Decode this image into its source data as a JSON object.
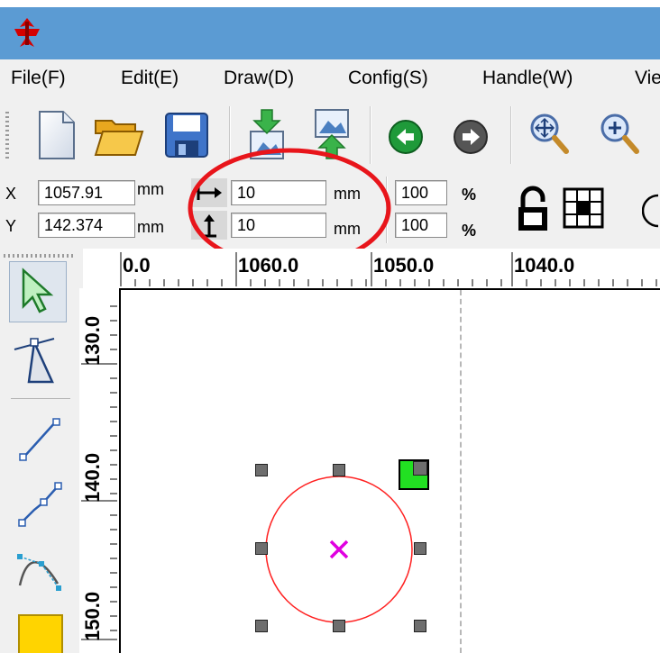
{
  "window": {
    "logo_icon": "app-logo-icon",
    "accent": "#5b9bd3"
  },
  "menu": {
    "items": [
      "File(F)",
      "Edit(E)",
      "Draw(D)",
      "Config(S)",
      "Handle(W)",
      "Vie"
    ]
  },
  "toolbar": {
    "icons": [
      "new-file-icon",
      "open-folder-icon",
      "save-icon",
      "import-icon",
      "export-icon",
      "back-arrow-icon",
      "forward-arrow-icon",
      "zoom-pan-icon",
      "zoom-in-icon"
    ]
  },
  "position": {
    "x_label": "X",
    "x_value": "1057.91",
    "x_unit": "mm",
    "y_label": "Y",
    "y_value": "142.374",
    "y_unit": "mm"
  },
  "size": {
    "width_value": "10",
    "width_unit": "mm",
    "height_value": "10",
    "height_unit": "mm"
  },
  "scale": {
    "x_value": "100",
    "x_unit": "%",
    "y_value": "100",
    "y_unit": "%"
  },
  "ruler": {
    "top_labels": [
      "0.0",
      "1060.0",
      "1050.0",
      "1040.0"
    ],
    "left_labels": [
      "130.0",
      "140.0",
      "150.0"
    ]
  },
  "tools": [
    "select-arrow-icon",
    "node-edit-icon",
    "line-icon",
    "polyline-icon",
    "bezier-curve-icon",
    "rectangle-icon"
  ],
  "colors": {
    "highlight_ellipse": "#e8151b",
    "circle_stroke": "#ff2020",
    "center_mark": "#e000e0",
    "corner_handle": "#22e022"
  }
}
